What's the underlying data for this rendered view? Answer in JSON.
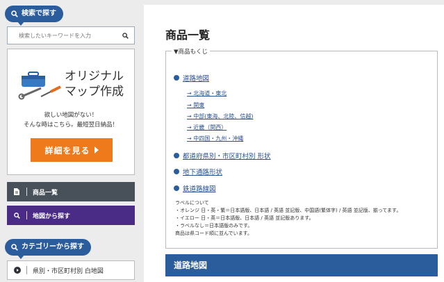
{
  "sidebar": {
    "search_pill": "検索で探す",
    "search_placeholder": "検索したいキーワードを入力",
    "promo": {
      "title": "オリジナル\nマップ作成",
      "desc": "欲しい地図がない！\nそんな時はこちら。最短翌日納品！",
      "cta": "詳細を見る"
    },
    "nav": [
      {
        "label": "商品一覧",
        "color": "#48505a"
      },
      {
        "label": "地図から探す",
        "color": "#4a2c86"
      }
    ],
    "category_pill": "カテゴリーから探す",
    "category_items": [
      "県別・市区町村別 白地図"
    ]
  },
  "main": {
    "title": "商品一覧",
    "toc_label": "▼商品もくじ",
    "toc": [
      {
        "label": "道路地図",
        "subs": [
          "→ 北海道・東北",
          "→ 関東",
          "→ 中部(東海、北陸、信越)",
          "→ 近畿（関西）",
          "→ 中四国・九州・沖縄"
        ]
      },
      {
        "label": "都道府県別・市区町村別 形状",
        "subs": []
      },
      {
        "label": "地下通路形状",
        "subs": []
      },
      {
        "label": "鉄道路線図",
        "subs": []
      }
    ],
    "note": "ラベルについて\n・オレンジ 日・英・繁＝日本語版、日本語 / 英語 並記版、中国語(繁体字) / 英語 並記版、揃ってます。\n・イエロー 日・英＝日本語版、日本語 / 英語 並記版あります。\n・ラベルなし＝日本語版のみです。\n商品は県コード順に並んでいます。",
    "section_title": "道路地図"
  },
  "colors": {
    "accent": "#2b5d9d",
    "cta": "#ee7a1c"
  }
}
